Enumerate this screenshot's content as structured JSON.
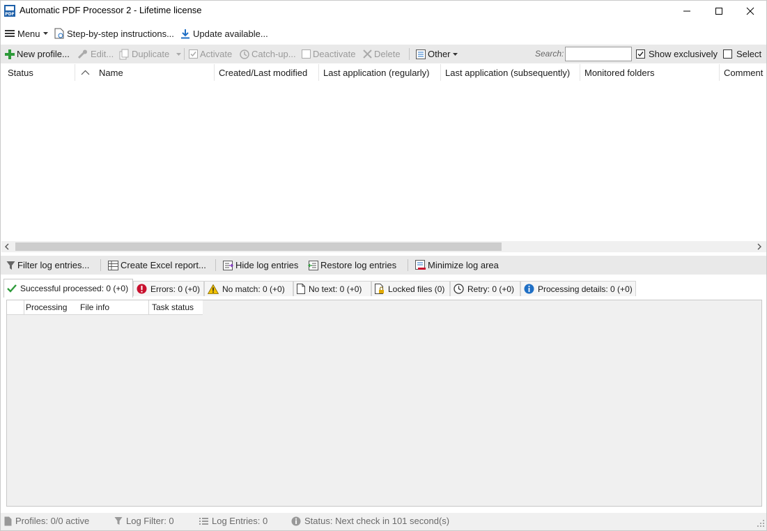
{
  "window": {
    "title": "Automatic PDF Processor 2 - Lifetime license",
    "app_icon_text": "PDF"
  },
  "menubar": {
    "menu_label": "Menu",
    "instructions_label": "Step-by-step instructions...",
    "update_label": "Update available..."
  },
  "toolbar": {
    "new_profile": "New profile...",
    "edit": "Edit...",
    "duplicate": "Duplicate",
    "activate": "Activate",
    "catch_up": "Catch-up...",
    "deactivate": "Deactivate",
    "delete": "Delete",
    "other": "Other",
    "search_label": "Search:",
    "search_value": "",
    "show_exclusively": "Show exclusively",
    "show_exclusively_checked": true,
    "select": "Select",
    "select_checked": false
  },
  "grid": {
    "columns": [
      "Status",
      "Name",
      "Created/Last modified",
      "Last application (regularly)",
      "Last application (subsequently)",
      "Monitored folders",
      "Comment"
    ],
    "sort_column": "Name",
    "rows": []
  },
  "log_toolbar": {
    "filter": "Filter log entries...",
    "excel": "Create Excel report...",
    "hide": "Hide log entries",
    "restore": "Restore log entries",
    "minimize": "Minimize log area"
  },
  "log_tabs": [
    {
      "label": "Successful processed: 0  (+0)",
      "active": true
    },
    {
      "label": "Errors: 0  (+0)",
      "active": false
    },
    {
      "label": "No match: 0  (+0)",
      "active": false
    },
    {
      "label": "No text: 0  (+0)",
      "active": false
    },
    {
      "label": "Locked files (0)",
      "active": false
    },
    {
      "label": "Retry: 0  (+0)",
      "active": false
    },
    {
      "label": "Processing details: 0  (+0)",
      "active": false
    }
  ],
  "log_table": {
    "columns": [
      "Processing",
      "File info",
      "Task status"
    ]
  },
  "statusbar": {
    "profiles": "Profiles: 0/0 active",
    "log_filter": "Log Filter: 0",
    "log_entries": "Log Entries: 0",
    "status": "Status: Next check in 101 second(s)"
  },
  "colors": {
    "accent_green": "#2e9a3a",
    "error_red": "#c8102e",
    "warning_yellow": "#f2c200",
    "info_blue": "#1f6fc5",
    "pdf_blue": "#1d5fa8"
  }
}
